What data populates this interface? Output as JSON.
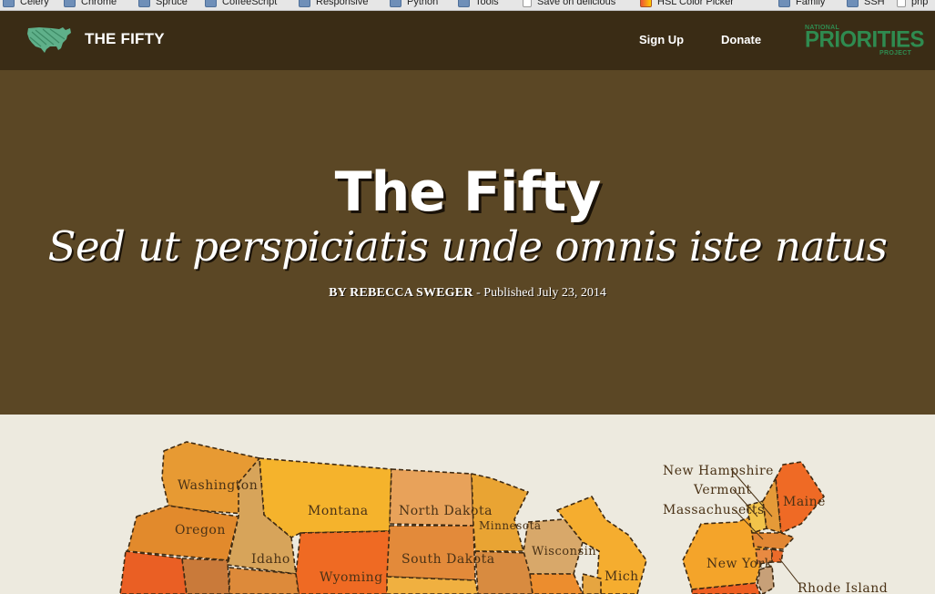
{
  "bookmarks": [
    {
      "label": "Celery",
      "icon": "folder-icon"
    },
    {
      "label": "Chrome",
      "icon": "folder-icon"
    },
    {
      "label": "Spruce",
      "icon": "folder-icon"
    },
    {
      "label": "CoffeeScript",
      "icon": "folder-icon"
    },
    {
      "label": "Responsive",
      "icon": "folder-icon"
    },
    {
      "label": "Python",
      "icon": "folder-icon"
    },
    {
      "label": "Tools",
      "icon": "folder-icon"
    },
    {
      "label": "Save on delicious",
      "icon": "page-icon"
    },
    {
      "label": "HSL Color Picker",
      "icon": "color-picker-icon"
    },
    {
      "label": "Family",
      "icon": "folder-icon"
    },
    {
      "label": "SSH",
      "icon": "folder-icon"
    },
    {
      "label": "php",
      "icon": "page-icon"
    }
  ],
  "header": {
    "brand": "THE FIFTY",
    "nav": {
      "signup": "Sign Up",
      "donate": "Donate"
    },
    "partner_logo": {
      "line1": "NATIONAL",
      "line2": "PRIORITIES",
      "line3": "PROJECT"
    }
  },
  "hero": {
    "title": "The Fifty",
    "subtitle": "Sed ut perspiciatis unde omnis iste natus",
    "byline_author": "BY REBECCA SWEGER",
    "byline_date": "- Published July 23, 2014"
  },
  "map": {
    "labels": {
      "washington": "Washington",
      "oregon": "Oregon",
      "idaho": "Idaho",
      "montana": "Montana",
      "wyoming": "Wyoming",
      "north_dakota": "North Dakota",
      "south_dakota": "South Dakota",
      "minnesota": "Minnesota",
      "wisconsin": "Wisconsin",
      "michigan": "Mich",
      "new_hampshire": "New Hampshire",
      "vermont": "Vermont",
      "massachusetts": "Massachusetts",
      "maine": "Maine",
      "new_york": "New York",
      "rhode_island": "Rhode Island"
    }
  },
  "colors": {
    "header_bg": "#3a2c15",
    "hero_bg": "#5b4725",
    "map_bg": "#edeadf",
    "brand_green": "#2f8b50"
  }
}
